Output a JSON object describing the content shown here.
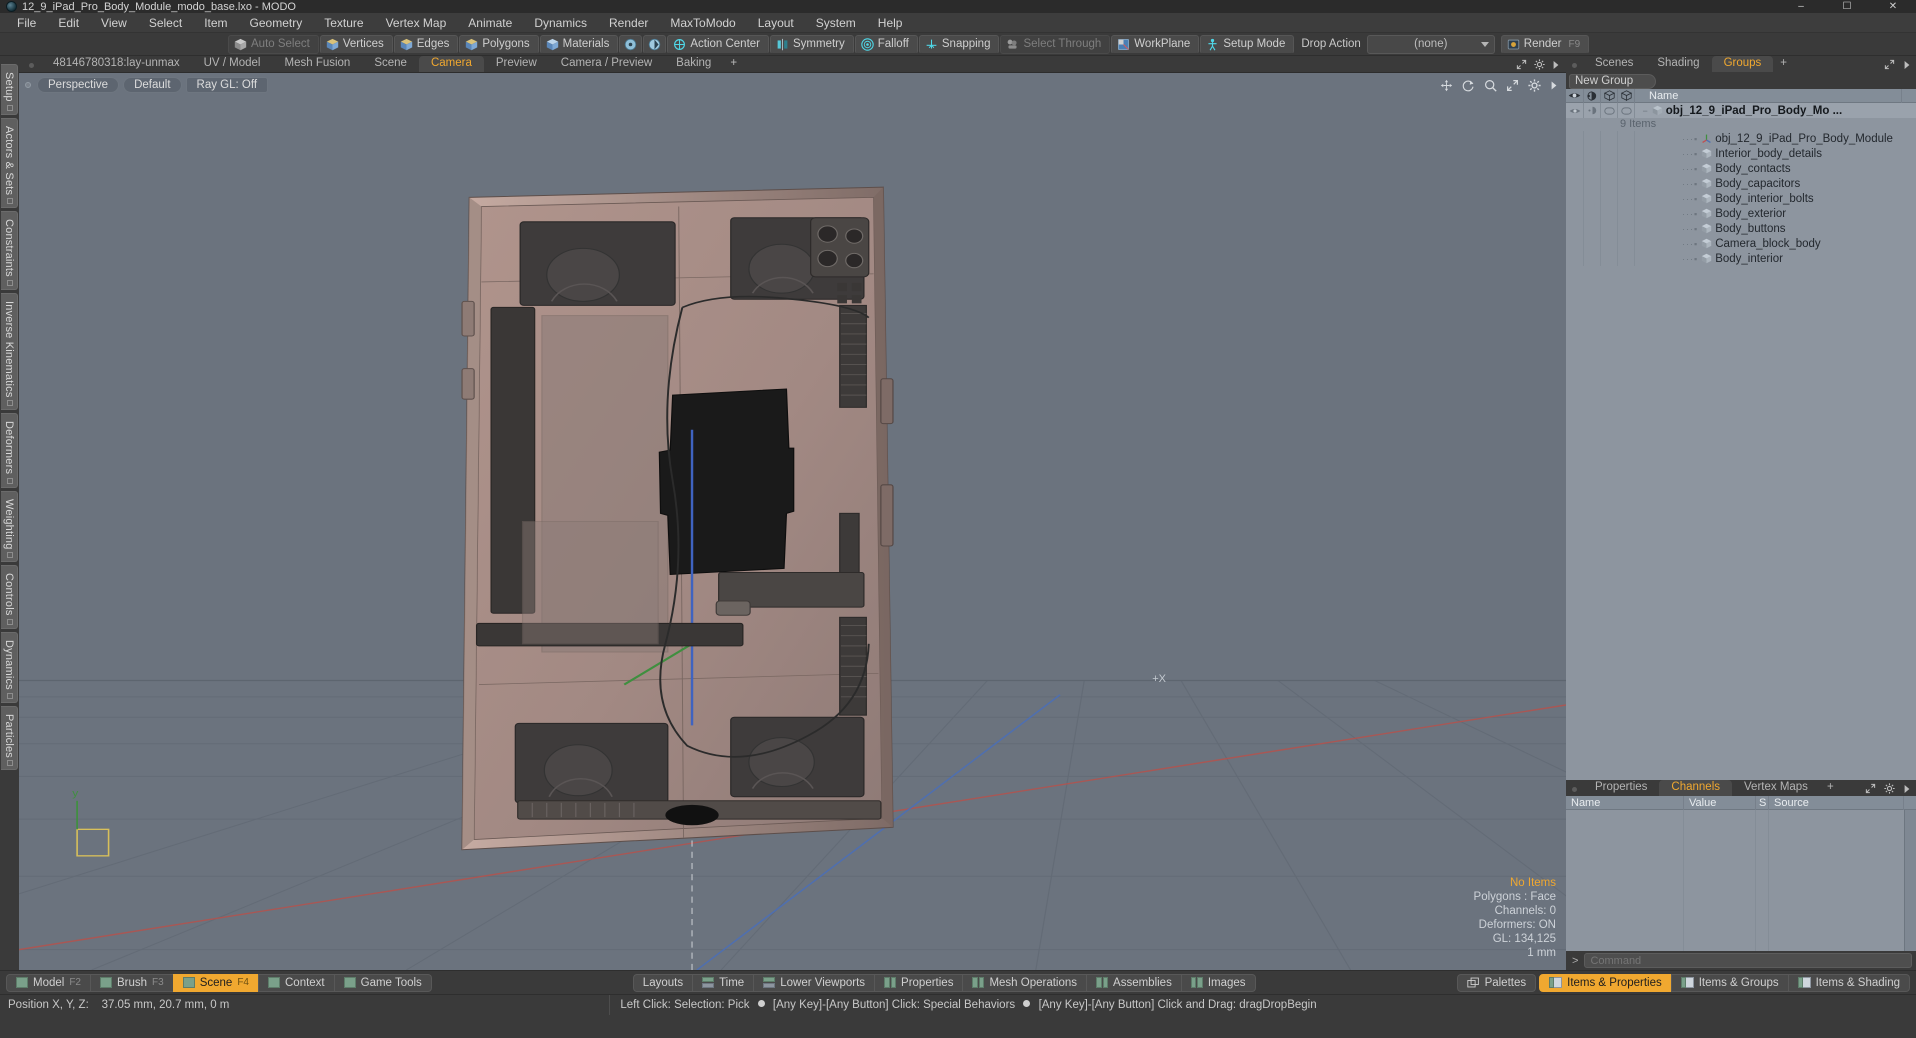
{
  "window": {
    "title": "12_9_iPad_Pro_Body_Module_modo_base.lxo - MODO",
    "logo_icon": "modo-logo-icon",
    "minimize": "–",
    "maximize": "☐",
    "close": "✕"
  },
  "menu": {
    "items": [
      {
        "label": "File"
      },
      {
        "label": "Edit"
      },
      {
        "label": "View"
      },
      {
        "label": "Select"
      },
      {
        "label": "Item"
      },
      {
        "label": "Geometry"
      },
      {
        "label": "Texture"
      },
      {
        "label": "Vertex Map"
      },
      {
        "label": "Animate"
      },
      {
        "label": "Dynamics"
      },
      {
        "label": "Render"
      },
      {
        "label": "MaxToModo"
      },
      {
        "label": "Layout"
      },
      {
        "label": "System"
      },
      {
        "label": "Help"
      }
    ]
  },
  "toolbar": {
    "buttons": [
      {
        "label": "Auto Select",
        "icon": "cube-grey-icon",
        "dim": true
      },
      {
        "label": "Vertices",
        "icon": "cube-vertices-icon",
        "dim": false
      },
      {
        "label": "Edges",
        "icon": "cube-edges-icon",
        "dim": false
      },
      {
        "label": "Polygons",
        "icon": "cube-polygons-icon",
        "dim": false
      },
      {
        "label": "Materials",
        "icon": "cube-materials-icon",
        "dim": false
      }
    ],
    "small_icons": [
      {
        "name": "select-center-icon"
      },
      {
        "name": "select-pivot-icon"
      }
    ],
    "action_center": {
      "label": "Action Center",
      "icon": "action-center-icon"
    },
    "symmetry": {
      "label": "Symmetry",
      "icon": "symmetry-icon"
    },
    "falloff": {
      "label": "Falloff",
      "icon": "falloff-icon"
    },
    "snapping": {
      "label": "Snapping",
      "icon": "snapping-icon"
    },
    "select_through": {
      "label": "Select Through",
      "icon": "select-through-icon",
      "dim": true
    },
    "workplane": {
      "label": "WorkPlane",
      "icon": "workplane-icon"
    },
    "setup_mode": {
      "label": "Setup Mode",
      "icon": "setup-mode-icon"
    },
    "drop_action": {
      "label": "Drop Action"
    },
    "drop_action_value": "(none)",
    "render": {
      "label": "Render",
      "shortcut": "F9",
      "icon": "render-icon"
    }
  },
  "left_rail": {
    "tabs": [
      {
        "label": "Setup"
      },
      {
        "label": "Actors & Sets"
      },
      {
        "label": "Constraints"
      },
      {
        "label": "Inverse Kinematics"
      },
      {
        "label": "Deformers"
      },
      {
        "label": "Weighting"
      },
      {
        "label": "Controls"
      },
      {
        "label": "Dynamics"
      },
      {
        "label": "Particles"
      }
    ]
  },
  "viewport_tabs": {
    "items": [
      {
        "label": "48146780318:lay-unmax",
        "active": false
      },
      {
        "label": "UV / Model",
        "active": false
      },
      {
        "label": "Mesh Fusion",
        "active": false
      },
      {
        "label": "Scene",
        "active": false
      },
      {
        "label": "Camera",
        "active": true
      },
      {
        "label": "Preview",
        "active": false
      },
      {
        "label": "Camera / Preview",
        "active": false
      },
      {
        "label": "Baking",
        "active": false
      }
    ],
    "add_label": "+",
    "right_icons": [
      {
        "name": "expand-arrows-icon"
      },
      {
        "name": "gear-icon"
      },
      {
        "name": "chevron-right-icon"
      }
    ]
  },
  "viewport": {
    "mode_buttons": [
      {
        "label": "Perspective",
        "icon": "view-dot-icon"
      },
      {
        "label": "Default"
      },
      {
        "label": "Ray GL: Off"
      }
    ],
    "nav_icons": [
      {
        "name": "pan-icon"
      },
      {
        "name": "rotate-icon"
      },
      {
        "name": "zoom-icon"
      },
      {
        "name": "fit-icon"
      },
      {
        "name": "gear-icon"
      },
      {
        "name": "chevron-right-icon"
      }
    ],
    "axis_hint": "+X",
    "stats": [
      {
        "label": "No Items",
        "highlight": true
      },
      {
        "label": "Polygons : Face",
        "highlight": false
      },
      {
        "label": "Channels: 0",
        "highlight": false
      },
      {
        "label": "Deformers: ON",
        "highlight": false
      },
      {
        "label": "GL: 134,125",
        "highlight": false
      },
      {
        "label": "1 mm",
        "highlight": false
      }
    ]
  },
  "right_dock": {
    "tabs": [
      {
        "label": "Scenes",
        "active": false
      },
      {
        "label": "Shading",
        "active": false
      },
      {
        "label": "Groups",
        "active": true
      }
    ],
    "add_label": "+",
    "right_icons": [
      {
        "name": "expand-arrows-icon"
      },
      {
        "name": "chevron-right-icon"
      }
    ],
    "new_group_label": "New Group",
    "tree_columns": [
      {
        "name": "visibility-eye-column",
        "glyph": "eye"
      },
      {
        "name": "shading-column",
        "glyph": "shade"
      },
      {
        "name": "wireframe-column-1",
        "glyph": "cube"
      },
      {
        "name": "wireframe-column-2",
        "glyph": "cube"
      },
      {
        "name": "name-column",
        "label": "Name"
      }
    ],
    "root_item": {
      "label": "obj_12_9_iPad_Pro_Body_Mo ...",
      "count_label": "9 Items",
      "icon": "group-icon"
    },
    "items": [
      {
        "label": "obj_12_9_iPad_Pro_Body_Module",
        "icon": "locator-axis-icon"
      },
      {
        "label": "Interior_body_details",
        "icon": "mesh-cube-icon"
      },
      {
        "label": "Body_contacts",
        "icon": "mesh-cube-icon"
      },
      {
        "label": "Body_capacitors",
        "icon": "mesh-cube-icon"
      },
      {
        "label": "Body_interior_bolts",
        "icon": "mesh-cube-icon"
      },
      {
        "label": "Body_exterior",
        "icon": "mesh-cube-icon"
      },
      {
        "label": "Body_buttons",
        "icon": "mesh-cube-icon"
      },
      {
        "label": "Camera_block_body",
        "icon": "mesh-cube-icon"
      },
      {
        "label": "Body_interior",
        "icon": "mesh-cube-icon"
      }
    ]
  },
  "lower_dock": {
    "tabs": [
      {
        "label": "Properties",
        "active": false
      },
      {
        "label": "Channels",
        "active": true
      },
      {
        "label": "Vertex Maps",
        "active": false
      }
    ],
    "add_label": "+",
    "right_icons": [
      {
        "name": "expand-arrows-icon"
      },
      {
        "name": "gear-icon"
      },
      {
        "name": "chevron-right-icon"
      }
    ],
    "columns": [
      {
        "label": "Name"
      },
      {
        "label": "Value"
      },
      {
        "label": "S"
      },
      {
        "label": "Source"
      }
    ],
    "rows": [],
    "command_placeholder": "Command",
    "command_prompt": ">"
  },
  "bottom_bar": {
    "mode_buttons": [
      {
        "label": "Model",
        "shortcut": "F2",
        "active": false,
        "icon": "layout-swatch-icon"
      },
      {
        "label": "Brush",
        "shortcut": "F3",
        "active": false,
        "icon": "layout-swatch-icon"
      },
      {
        "label": "Scene",
        "shortcut": "F4",
        "active": true,
        "icon": "layout-swatch-icon"
      },
      {
        "label": "Context",
        "shortcut": "",
        "active": false,
        "icon": "layout-swatch-icon"
      },
      {
        "label": "Game Tools",
        "shortcut": "",
        "active": false,
        "icon": "layout-swatch-icon"
      }
    ],
    "center_buttons": [
      {
        "label": "Layouts",
        "icon": null
      },
      {
        "label": "Time",
        "icon": "split-h-icon"
      },
      {
        "label": "Lower Viewports",
        "icon": "split-h-icon"
      },
      {
        "label": "Properties",
        "icon": "split-v-icon"
      },
      {
        "label": "Mesh Operations",
        "icon": "split-v-icon"
      },
      {
        "label": "Assemblies",
        "icon": "split-v-icon"
      },
      {
        "label": "Images",
        "icon": "split-v-icon"
      }
    ],
    "right_buttons": [
      {
        "label": "Palettes",
        "icon": "palettes-icon",
        "active": false
      },
      {
        "label": "Items & Properties",
        "icon": "split-panel-icon",
        "active": true
      },
      {
        "label": "Items & Groups",
        "icon": "split-panel-icon",
        "active": false
      },
      {
        "label": "Items & Shading",
        "icon": "split-panel-icon",
        "active": false
      }
    ]
  },
  "status_bar": {
    "position_label": "Position X, Y, Z:",
    "position_value": "37.05 mm, 20.7 mm, 0 m",
    "hint_1": "Left Click: Selection: Pick",
    "hint_2": "[Any Key]-[Any Button] Click: Special Behaviors",
    "hint_3": "[Any Key]-[Any Button] Click and Drag: dragDropBegin"
  },
  "colors": {
    "accent": "#f0a830",
    "viewport_bg": "#6b737e",
    "panel_bg": "#3a3a3a",
    "tree_bg": "#8d959f",
    "device_body": "#a88d85"
  }
}
